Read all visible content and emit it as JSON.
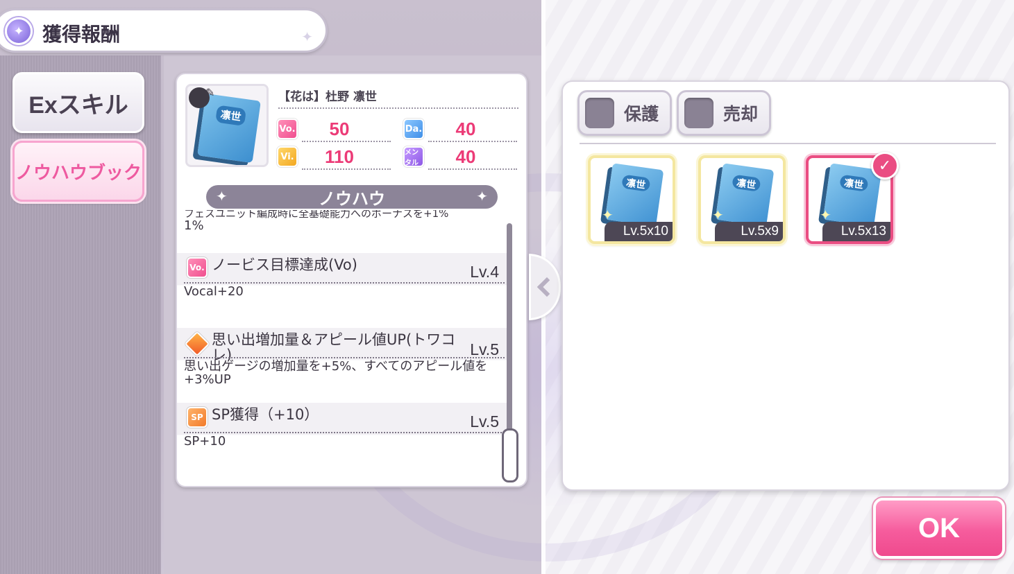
{
  "header": {
    "title": "獲得報酬"
  },
  "tabs": [
    {
      "label": "Exスキル",
      "active": false
    },
    {
      "label": "ノウハウブック",
      "active": true
    }
  ],
  "detail": {
    "book_cover_text": "凛世",
    "character_name": "【花は】杜野 凛世",
    "stats": {
      "vo": {
        "badge": "Vo.",
        "value": "50"
      },
      "da": {
        "badge": "Da.",
        "value": "40"
      },
      "vi": {
        "badge": "Vi.",
        "value": "110"
      },
      "me": {
        "badge": "メンタル",
        "value": "40"
      }
    },
    "section_title": "ノウハウ",
    "cut_text": "フェスユニット編成時に全基礎能力へのボーナスを+1%",
    "cut_text_tail": "1%",
    "skills": [
      {
        "icon": "Vo.",
        "name": "ノービス目標達成(Vo)",
        "level": "Lv.4",
        "desc": "Vocal+20"
      },
      {
        "icon": "",
        "name": "思い出増加量＆アピール値UP(トワコレ)",
        "level": "Lv.5",
        "desc": "思い出ゲージの増加量を+5%、すべてのアピール値を+3%UP"
      },
      {
        "icon": "SP",
        "name": "SP獲得（+10）",
        "level": "Lv.5",
        "desc": "SP+10"
      }
    ]
  },
  "filters": {
    "protect_label": "保護",
    "sell_label": "売却"
  },
  "items": [
    {
      "cover": "凛世",
      "level": "Lv.5x10",
      "selected": false
    },
    {
      "cover": "凛世",
      "level": "Lv.5x9",
      "selected": false
    },
    {
      "cover": "凛世",
      "level": "Lv.5x13",
      "selected": true
    }
  ],
  "ok_label": "OK",
  "colors": {
    "accent_pink": "#ea4d82",
    "stat_value": "#ec3b77",
    "panel_grey": "#8c8498"
  }
}
